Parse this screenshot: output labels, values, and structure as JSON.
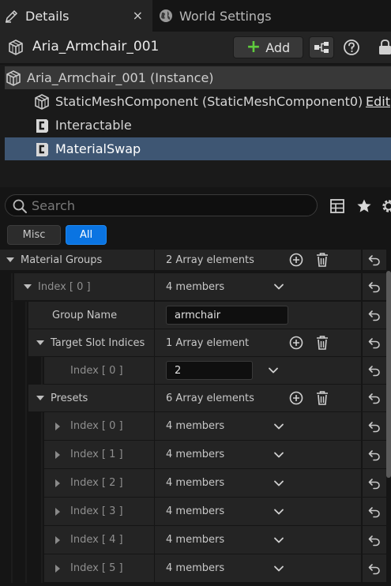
{
  "tabs": {
    "details_label": "Details",
    "details_close": "×",
    "world_settings_label": "World Settings"
  },
  "header": {
    "actor_name": "Aria_Armchair_001",
    "add_label": "Add"
  },
  "components": {
    "root_label": "Aria_Armchair_001 (Instance)",
    "items": [
      {
        "label": "StaticMeshComponent (StaticMeshComponent0)",
        "action": "Edit"
      },
      {
        "label": "Interactable"
      },
      {
        "label": "MaterialSwap"
      }
    ]
  },
  "search": {
    "placeholder": "Search"
  },
  "filters": {
    "misc": "Misc",
    "all": "All"
  },
  "properties": {
    "material_groups": {
      "name": "Material Groups",
      "value": "2 Array elements"
    },
    "index0": {
      "name": "Index [ 0 ]",
      "value": "4 members"
    },
    "group_name": {
      "name": "Group Name",
      "value": "armchair"
    },
    "target_slot_indices": {
      "name": "Target Slot Indices",
      "value": "1 Array element"
    },
    "target_slot_index0": {
      "name": "Index [ 0 ]",
      "value": "2"
    },
    "presets": {
      "name": "Presets",
      "value": "6 Array elements"
    },
    "preset_items": [
      {
        "name": "Index [ 0 ]",
        "value": "4 members"
      },
      {
        "name": "Index [ 1 ]",
        "value": "4 members"
      },
      {
        "name": "Index [ 2 ]",
        "value": "4 members"
      },
      {
        "name": "Index [ 3 ]",
        "value": "4 members"
      },
      {
        "name": "Index [ 4 ]",
        "value": "4 members"
      },
      {
        "name": "Index [ 5 ]",
        "value": "4 members"
      }
    ]
  },
  "colors": {
    "accent_blue": "#0a74e2",
    "selection": "#3e5673",
    "add_green": "#5fcb3e"
  }
}
